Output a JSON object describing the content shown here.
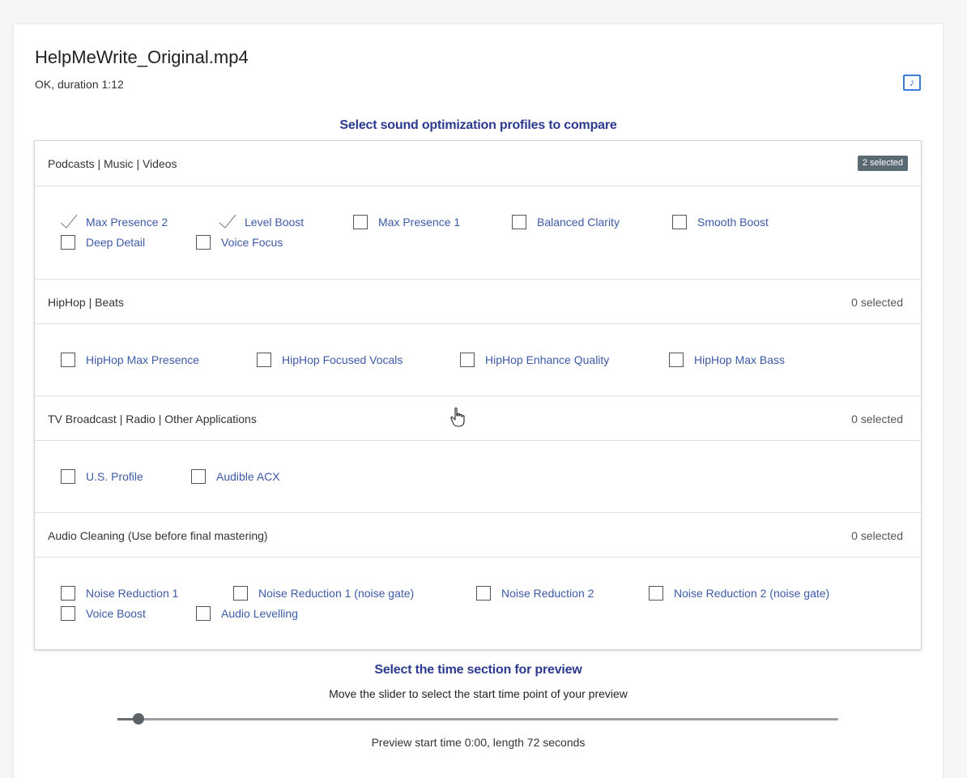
{
  "file": {
    "name": "HelpMeWrite_Original.mp4",
    "status": "OK, duration 1:12",
    "icon": "music-note-icon"
  },
  "profiles_heading": "Select sound optimization profiles to compare",
  "groups": [
    {
      "title": "Podcasts | Music | Videos",
      "count": "2 selected",
      "options": [
        {
          "label": "Max Presence 2",
          "checked": true
        },
        {
          "label": "Level Boost",
          "checked": true
        },
        {
          "label": "Max Presence 1",
          "checked": false
        },
        {
          "label": "Balanced Clarity",
          "checked": false
        },
        {
          "label": "Smooth Boost",
          "checked": false
        },
        {
          "label": "Deep Detail",
          "checked": false
        },
        {
          "label": "Voice Focus",
          "checked": false
        }
      ]
    },
    {
      "title": "HipHop | Beats",
      "count": "0 selected",
      "options": [
        {
          "label": "HipHop Max Presence",
          "checked": false
        },
        {
          "label": "HipHop Focused Vocals",
          "checked": false
        },
        {
          "label": "HipHop Enhance Quality",
          "checked": false
        },
        {
          "label": "HipHop Max Bass",
          "checked": false
        }
      ]
    },
    {
      "title": "TV Broadcast | Radio | Other Applications",
      "count": "0 selected",
      "options": [
        {
          "label": "U.S. Profile",
          "checked": false
        },
        {
          "label": "Audible ACX",
          "checked": false
        }
      ]
    },
    {
      "title": "Audio Cleaning (Use before final mastering)",
      "count": "0 selected",
      "options": [
        {
          "label": "Noise Reduction 1",
          "checked": false
        },
        {
          "label": "Noise Reduction 1 (noise gate)",
          "checked": false
        },
        {
          "label": "Noise Reduction 2",
          "checked": false
        },
        {
          "label": "Noise Reduction 2 (noise gate)",
          "checked": false
        },
        {
          "label": "Voice Boost",
          "checked": false
        },
        {
          "label": "Audio Levelling",
          "checked": false
        }
      ]
    }
  ],
  "preview": {
    "heading": "Select the time section for preview",
    "instructions": "Move the slider to select the start time point of your preview",
    "slider_value": 0,
    "status": "Preview start time 0:00, length 72 seconds"
  },
  "colors": {
    "accent": "#2b3a8f",
    "option_text": "#3d5aa6",
    "badge": "#5a6a73",
    "icon_blue": "#3a7bd5"
  }
}
